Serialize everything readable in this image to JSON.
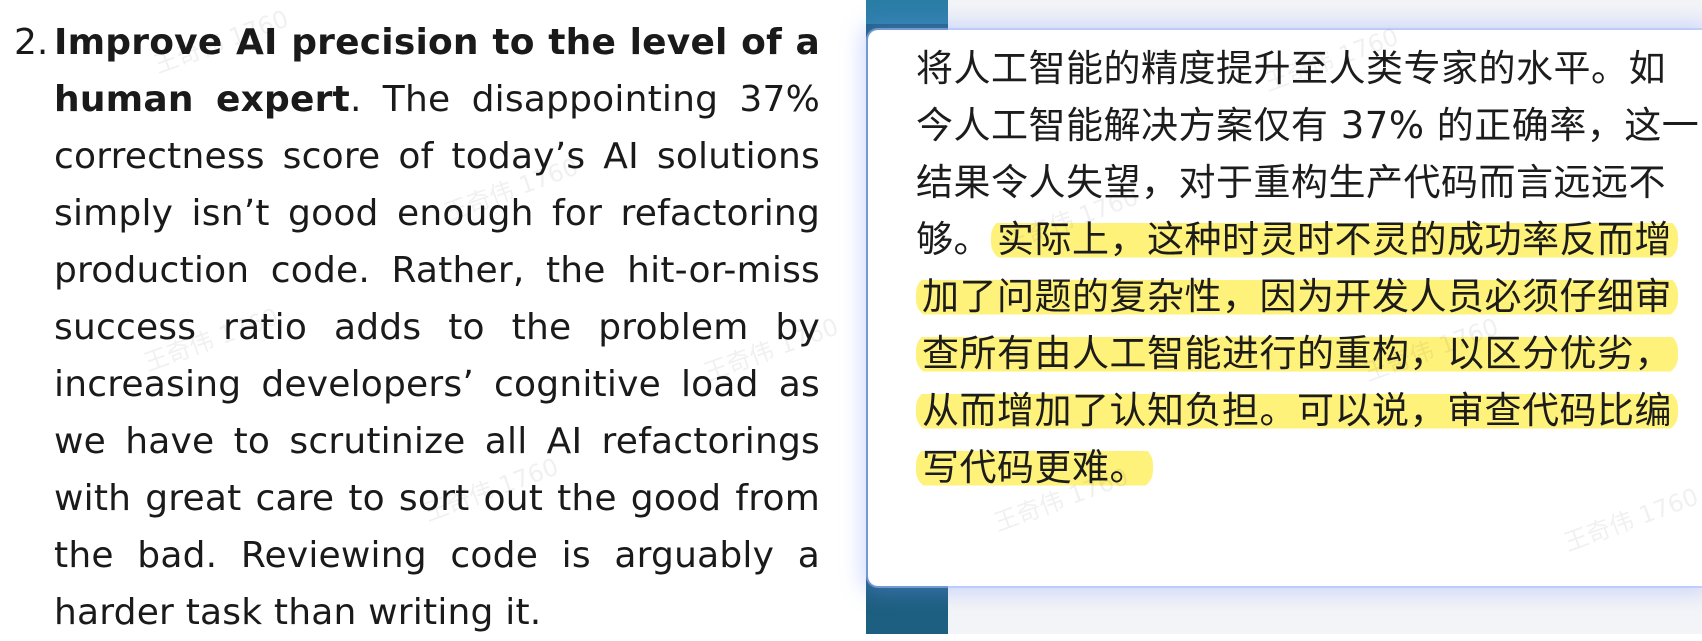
{
  "left": {
    "item_number": "2.",
    "bold_text": "Improve AI precision to the level of a human expert",
    "body_text": ". The disappointing 37% correctness score of today’s AI solutions simply isn’t good enough for refactoring production code. Rather, the hit-or-miss success ratio adds to the problem by increasing developers’ cognitive load as we have to scrutinize all AI refactorings with great care to sort out the good from the bad. Reviewing code is arguably a harder task than writing it."
  },
  "translation": {
    "plain_text": "将人工智能的精度提升至人类专家的水平。如今人工智能解决方案仅有 37% 的正确率，这一结果令人失望，对于重构生产代码而言远远不够。",
    "highlighted_text": "实际上，这种时灵时不灵的成功率反而增加了问题的复杂性，因为开发人员必须仔细审查所有由人工智能进行的重构，以区分优劣，从而增加了认知负担。可以说，审查代码比编写代码更难。",
    "highlight_color": "#fff27a"
  },
  "watermark": "王奇伟 1760"
}
